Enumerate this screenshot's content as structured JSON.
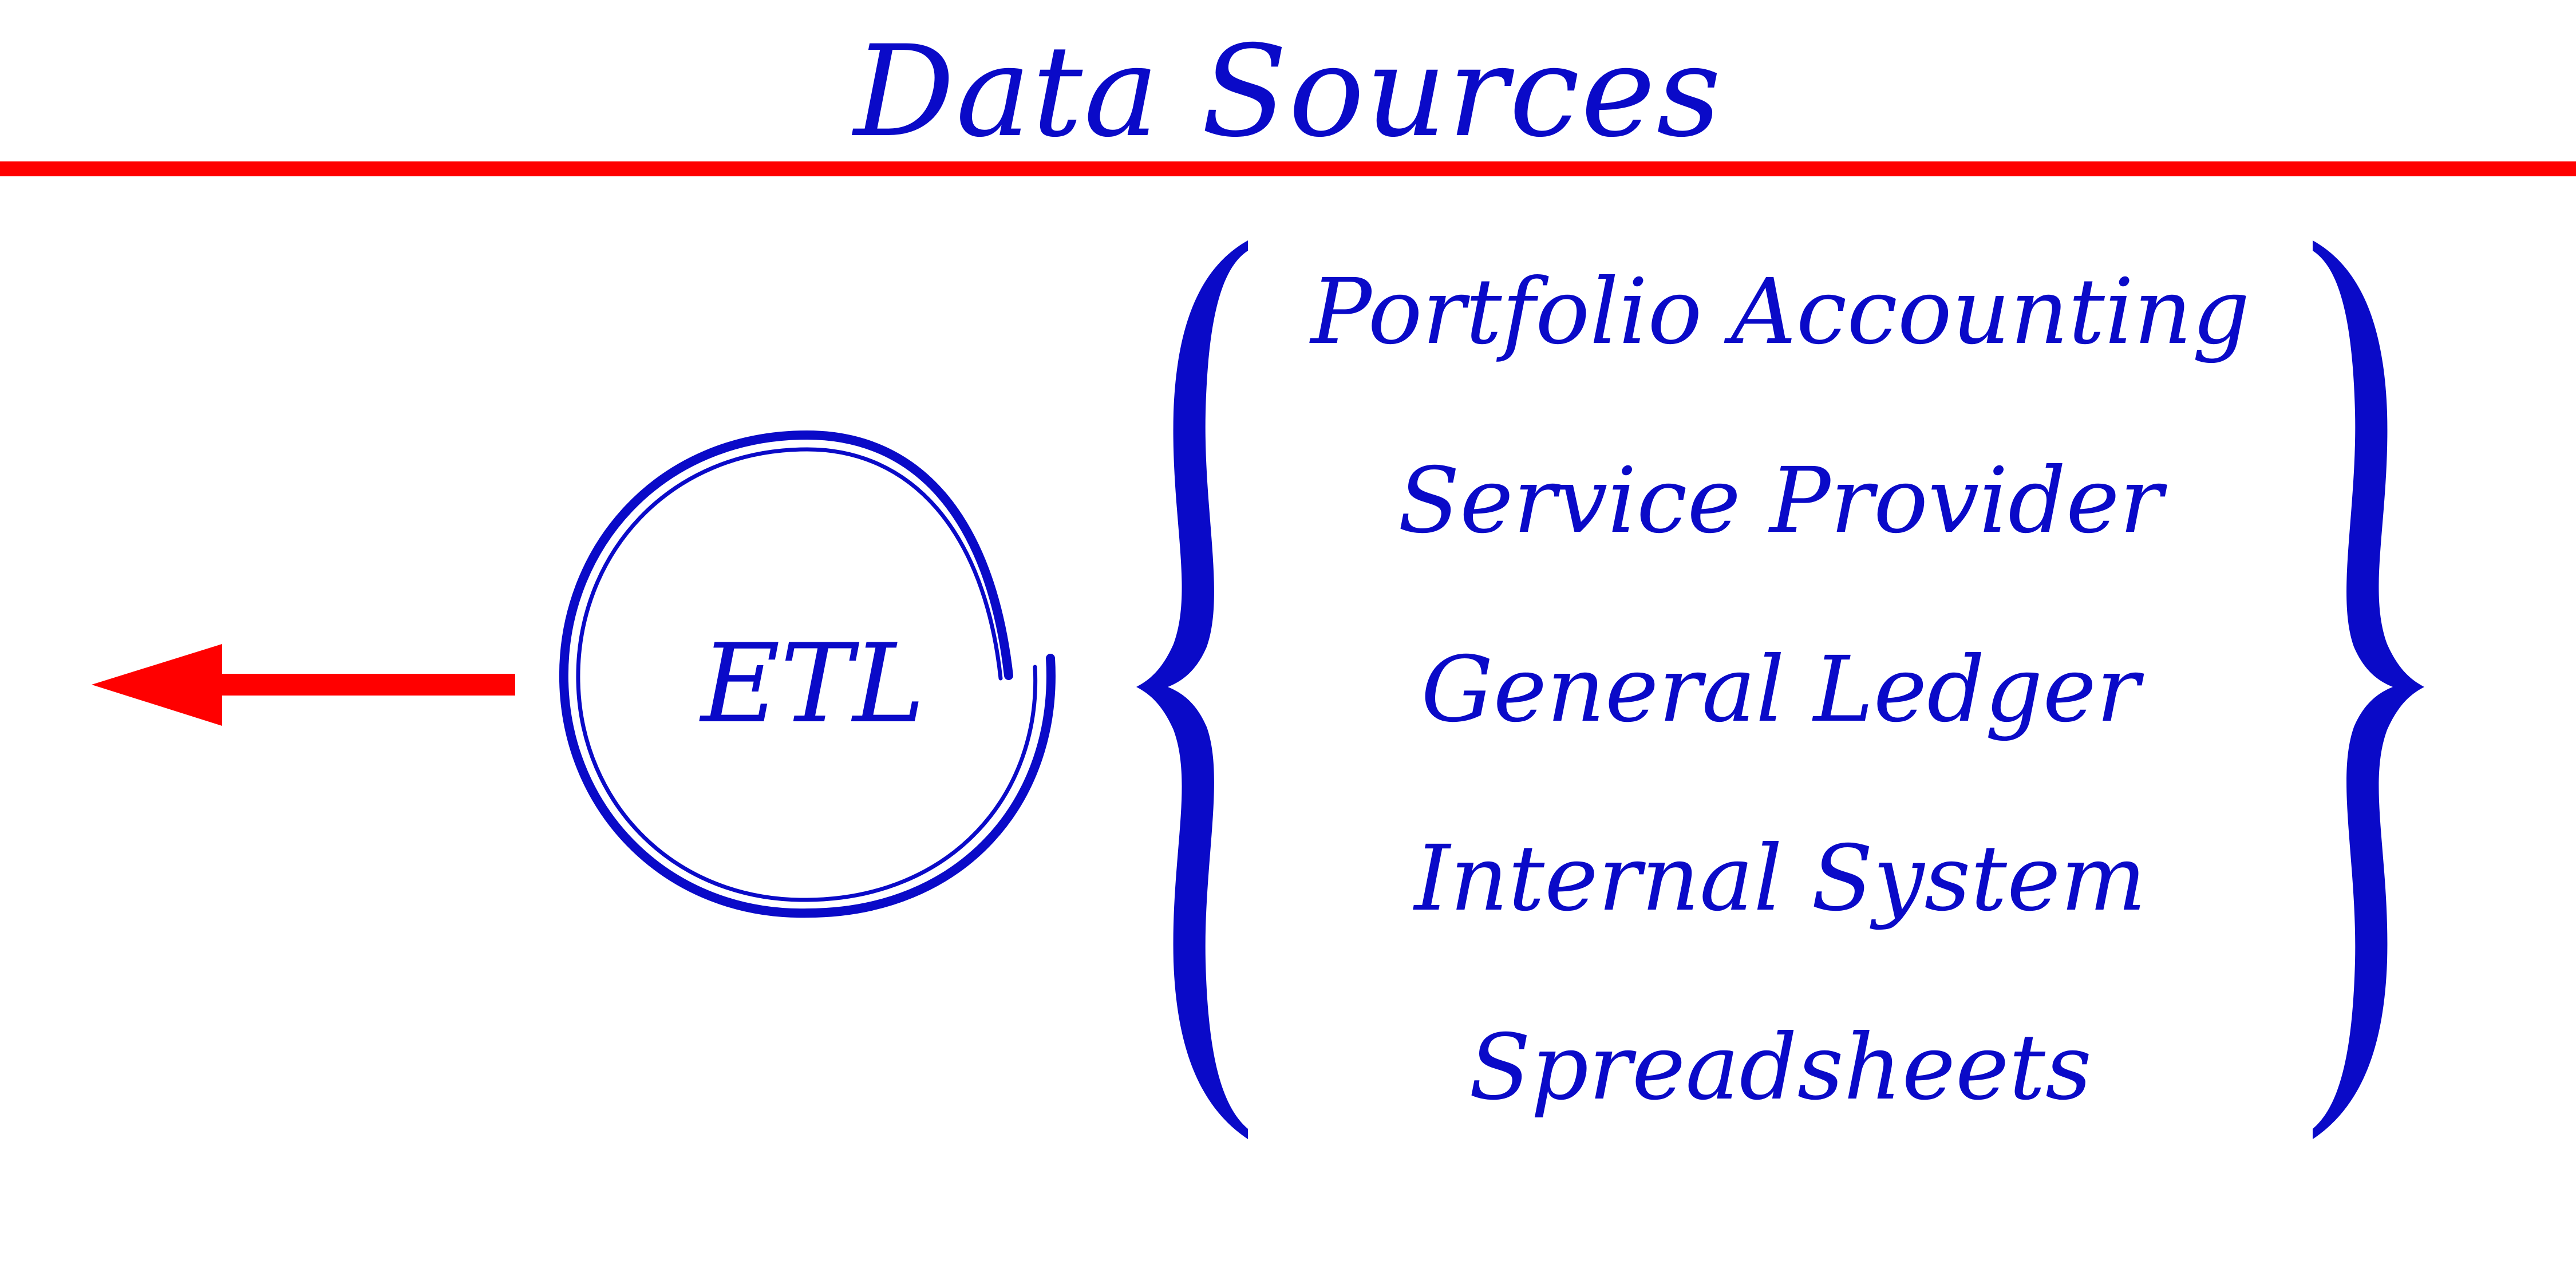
{
  "title": "Data Sources",
  "process": {
    "label": "ETL"
  },
  "sources": [
    {
      "label": "Portfolio Accounting"
    },
    {
      "label": "Service Provider"
    },
    {
      "label": "General Ledger"
    },
    {
      "label": "Internal System"
    },
    {
      "label": "Spreadsheets"
    }
  ],
  "colors": {
    "text": "#0a0ac8",
    "accent": "#ff0000",
    "background": "#ffffff"
  },
  "icons": {
    "arrow": "left-arrow-icon",
    "process": "circle-icon",
    "group": "curly-brace-icon"
  }
}
